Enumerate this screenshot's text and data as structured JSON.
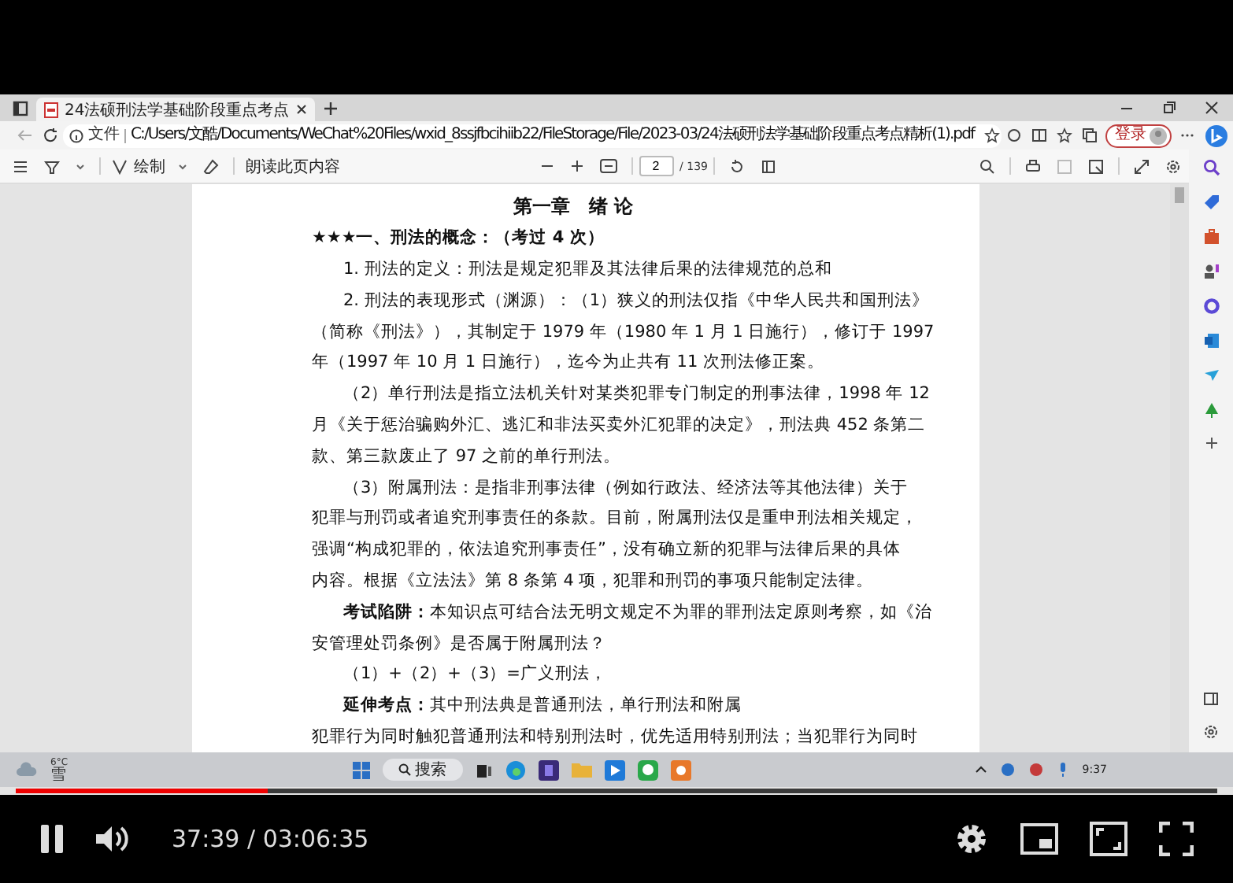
{
  "browser": {
    "tab": {
      "title": "24法硕刑法学基础阶段重点考点"
    },
    "address": {
      "scheme": "文件",
      "url": "C:/Users/文酷/Documents/WeChat%20Files/wxid_8ssjfbcihiib22/FileStorage/File/2023-03/24法硕刑法学基础阶段重点考点精析(1).pdf"
    },
    "login_button": "登录",
    "pdf_toolbar": {
      "draw_label": "绘制",
      "read_aloud": "朗读此页内容",
      "page": "2",
      "page_count": "/ 139"
    }
  },
  "document": {
    "title": "第一章　绪 论",
    "heading": "★★★一、刑法的概念：（考过 4 次）",
    "lines": [
      {
        "text": "1. 刑法的定义：刑法是规定犯罪及其法律后果的法律规范的总和",
        "indent": true
      },
      {
        "text": "2. 刑法的表现形式（渊源）：（1）狭义的刑法仅指《中华人民共和国刑法》",
        "indent": true
      },
      {
        "text": "（简称《刑法》），其制定于 1979 年（1980 年 1 月 1 日施行），修订于 1997",
        "indent": false
      },
      {
        "text": "年（1997 年 10 月 1 日施行），迄今为止共有 11 次刑法修正案。",
        "indent": false
      },
      {
        "text": "（2）单行刑法是指立法机关针对某类犯罪专门制定的刑事法律，1998 年 12",
        "indent": true
      },
      {
        "text": "月《关于惩治骗购外汇、逃汇和非法买卖外汇犯罪的决定》，刑法典 452 条第二",
        "indent": false
      },
      {
        "text": "款、第三款废止了 97 之前的单行刑法。",
        "indent": false
      },
      {
        "text": "（3）附属刑法：是指非刑事法律（例如行政法、经济法等其他法律）关于",
        "indent": true
      },
      {
        "text": "犯罪与刑罚或者追究刑事责任的条款。目前，附属刑法仅是重申刑法相关规定，",
        "indent": false
      },
      {
        "text": "强调“构成犯罪的，依法追究刑事责任”，没有确立新的犯罪与法律后果的具体",
        "indent": false
      },
      {
        "text": "内容。根据《立法法》第 8 条第 4 项，犯罪和刑罚的事项只能制定法律。",
        "indent": false
      },
      {
        "text": "**考试陷阱：**本知识点可结合法无明文规定不为罪的罪刑法定原则考察，如《治",
        "indent": true
      },
      {
        "text": "安管理处罚条例》是否属于附属刑法？",
        "indent": false
      },
      {
        "text": "（1）+（2）+（3）=广义刑法，",
        "indent": true
      },
      {
        "text": "**延伸考点：**其中刑法典是普通刑法，单行刑法和附属",
        "indent": true
      },
      {
        "text": "犯罪行为同时触犯普通刑法和特别刑法时，优先适用特别刑法；当犯罪行为同时",
        "indent": false
      }
    ]
  },
  "taskbar": {
    "temperature": "6°C",
    "weather": "雪",
    "search": "搜索",
    "time": "9:37"
  },
  "player": {
    "progress": {
      "level": 0.21
    },
    "time": "37:39 / 03:06:35"
  }
}
